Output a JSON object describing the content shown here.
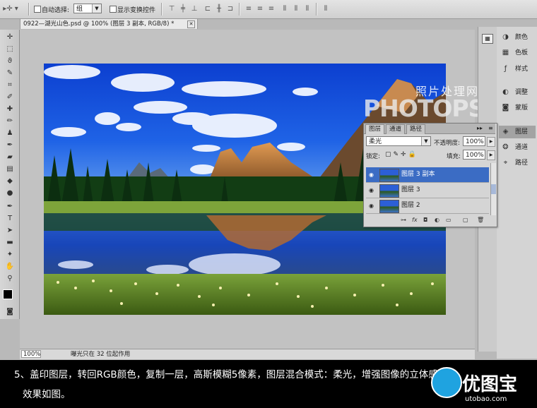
{
  "options_bar": {
    "auto_select_label": "自动选择:",
    "auto_select_value": "组",
    "show_transform_label": "显示变换控件"
  },
  "document": {
    "tab_title": "0922—湖光山色.psd @ 100% (图层 3 副本, RGB/8) *"
  },
  "status_bar": {
    "zoom": "100%",
    "info": "曝光只在 32 位起作用"
  },
  "watermark": {
    "line1": "照片处理网",
    "line2": "PHOTOPS.COM"
  },
  "dock": {
    "items": [
      {
        "label": "颜色",
        "icon": "color-icon"
      },
      {
        "label": "色板",
        "icon": "swatches-icon"
      },
      {
        "label": "样式",
        "icon": "styles-icon"
      },
      {
        "label": "调整",
        "icon": "adjustments-icon"
      },
      {
        "label": "蒙版",
        "icon": "masks-icon"
      },
      {
        "label": "图层",
        "icon": "layers-icon"
      },
      {
        "label": "通道",
        "icon": "channels-icon"
      },
      {
        "label": "路径",
        "icon": "paths-icon"
      }
    ]
  },
  "layers_panel": {
    "tabs": [
      "图层",
      "通道",
      "路径"
    ],
    "blend_mode": "柔光",
    "opacity_label": "不透明度:",
    "opacity_value": "100%",
    "lock_label": "锁定:",
    "fill_label": "填充:",
    "fill_value": "100%",
    "layers": [
      {
        "name": "图层 3 副本",
        "selected": true
      },
      {
        "name": "图层 3",
        "selected": false
      },
      {
        "name": "图层 2",
        "selected": false
      }
    ]
  },
  "caption": {
    "line1": "5、盖印图层，转回RGB颜色，复制一层，高斯模糊5像素，图层混合模式：柔光，增强图像的立体感",
    "line2": "效果如图。"
  },
  "logo": {
    "text": "优图宝",
    "url": "utobao.com"
  },
  "colors": {
    "selection": "#3b6cc4",
    "sky": "#1a4fd6",
    "caption_bg": "#000000"
  }
}
